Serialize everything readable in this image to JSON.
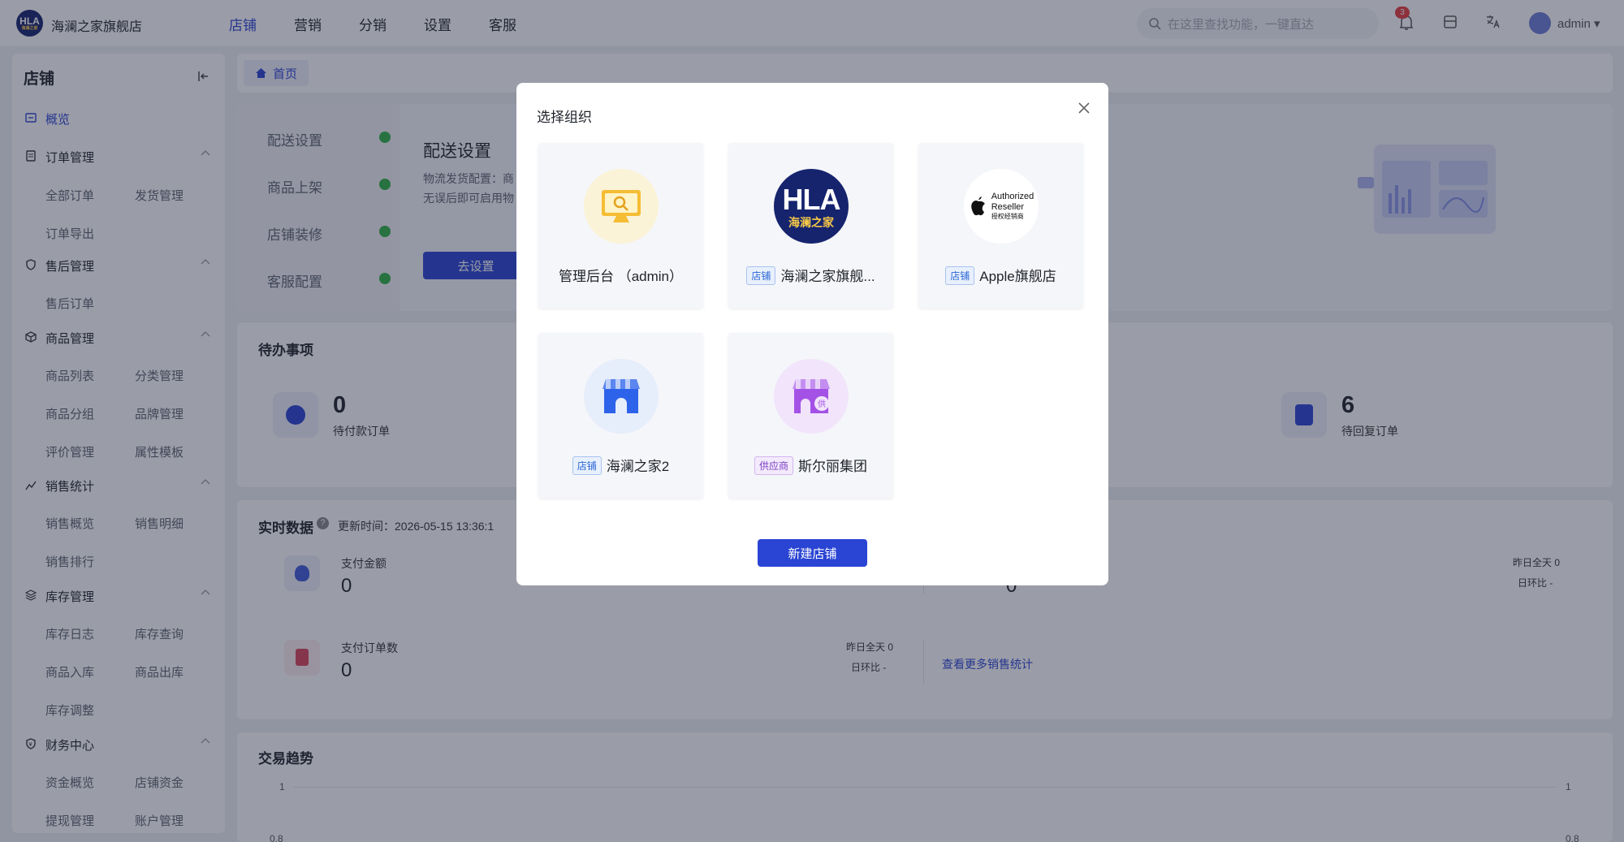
{
  "header": {
    "logo_text": "HLA",
    "logo_sub": "海澜之家",
    "store_name": "海澜之家旗舰店",
    "nav": [
      "店铺",
      "营销",
      "分销",
      "设置",
      "客服"
    ],
    "search_placeholder": "在这里查找功能，一键直达",
    "notification_count": "3",
    "user": "admin"
  },
  "sidebar": {
    "title": "店铺",
    "overview": "概览",
    "groups": [
      {
        "label": "订单管理",
        "items": [
          "全部订单",
          "发货管理",
          "订单导出"
        ]
      },
      {
        "label": "售后管理",
        "items": [
          "售后订单"
        ]
      },
      {
        "label": "商品管理",
        "items": [
          "商品列表",
          "分类管理",
          "商品分组",
          "品牌管理",
          "评价管理",
          "属性模板"
        ]
      },
      {
        "label": "销售统计",
        "items": [
          "销售概览",
          "销售明细",
          "销售排行"
        ]
      },
      {
        "label": "库存管理",
        "items": [
          "库存日志",
          "库存查询",
          "商品入库",
          "商品出库",
          "库存调整"
        ]
      },
      {
        "label": "财务中心",
        "items": [
          "资金概览",
          "店铺资金",
          "提现管理",
          "账户管理"
        ]
      }
    ]
  },
  "breadcrumb": {
    "home": "首页"
  },
  "setup": {
    "steps": [
      "配送设置",
      "商品上架",
      "店铺装修",
      "客服配置"
    ],
    "title": "配送设置",
    "desc_line1": "物流发货配置：商",
    "desc_line2": "无误后即可启用物",
    "button": "去设置"
  },
  "todo": {
    "title": "待办事项",
    "items": [
      {
        "value": "0",
        "label": "待付款订单"
      },
      {
        "value": "6",
        "label": "待回复订单"
      }
    ]
  },
  "realtime": {
    "title": "实时数据",
    "update_label": "更新时间：",
    "update_time": "2026-05-15 13:36:1",
    "metrics": [
      {
        "label": "支付金额",
        "value": "0"
      },
      {
        "label": "支付订单数",
        "value": "0",
        "yesterday": "昨日全天 0",
        "ratio": "日环比  -"
      }
    ],
    "right_yesterday": "昨日全天 0",
    "right_ratio": "日环比  -",
    "right_value": "0",
    "more_link": "查看更多销售统计"
  },
  "trend": {
    "title": "交易趋势",
    "y_top": "1",
    "y_next": "0.8",
    "y_top_right": "1",
    "y_next_right": "0.8"
  },
  "modal": {
    "title": "选择组织",
    "cards": [
      {
        "tag": "",
        "name": "管理后台 （admin）"
      },
      {
        "tag": "店铺",
        "name": "海澜之家旗舰..."
      },
      {
        "tag": "店铺",
        "name": "Apple旗舰店"
      },
      {
        "tag": "店铺",
        "name": "海澜之家2"
      },
      {
        "tag": "供应商",
        "name": "斯尔丽集团"
      }
    ],
    "hla_logo_text": "HLA",
    "hla_logo_sub": "海澜之家",
    "apple_text1": "Authorized",
    "apple_text2": "Reseller",
    "apple_text3": "授权经销商",
    "supplier_mark": "供",
    "new_button": "新建店铺"
  }
}
